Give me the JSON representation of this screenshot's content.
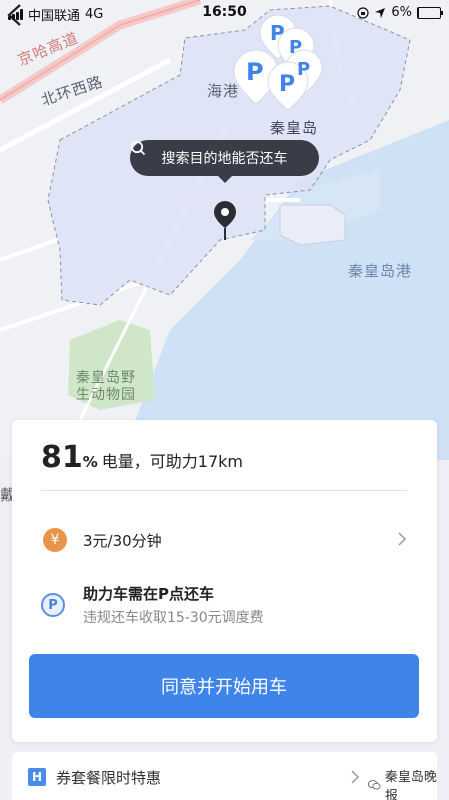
{
  "status_bar": {
    "carrier": "中国联通",
    "network": "4G",
    "time": "16:50",
    "battery_pct": "6%",
    "battery_level": 0.06
  },
  "map": {
    "labels": {
      "expressway": "京哈高道",
      "north_ring": "北环西路",
      "haigang": "海港",
      "qhd": "秦皇岛",
      "port": "秦皇岛港",
      "zoo": "秦皇岛野\n生动物园",
      "edge": "戴"
    },
    "parking_glyph": "P",
    "search_hint": "搜索目的地能否还车",
    "colors": {
      "zone_fill": "#dde2f7",
      "water": "#cfe1f4",
      "zoo_green": "#cfe6c9"
    }
  },
  "card": {
    "battery_number": "81",
    "battery_unit": "%",
    "battery_text": "电量，可助力17km",
    "price_icon": "¥",
    "price": "3元/30分钟",
    "park_icon": "P",
    "park_title": "助力车需在P点还车",
    "park_sub": "违规还车收取15-30元调度费",
    "start_button": "同意并开始用车"
  },
  "promo": {
    "icon": "H",
    "text": "券套餐限时特惠",
    "watermark": "秦皇岛晚报"
  },
  "colors": {
    "accent": "#3f84e9",
    "price_icon": "#e8944a"
  }
}
